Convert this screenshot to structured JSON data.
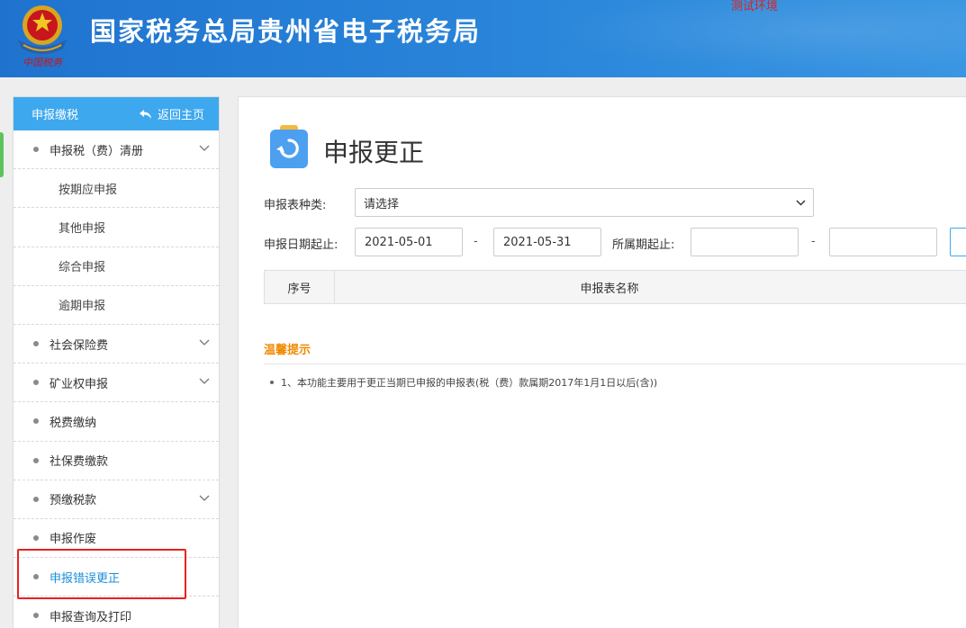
{
  "header": {
    "title": "国家税务总局贵州省电子税务局",
    "env_tag": "测试环境",
    "emblem_caption": "中国税务",
    "emblem": "tax-emblem-icon"
  },
  "sidebar": {
    "head_label": "申报缴税",
    "back_label": "返回主页",
    "items": [
      {
        "label": "申报税（费）清册",
        "type": "group",
        "expandable": true
      },
      {
        "label": "按期应申报",
        "type": "sub"
      },
      {
        "label": "其他申报",
        "type": "sub"
      },
      {
        "label": "综合申报",
        "type": "sub"
      },
      {
        "label": "逾期申报",
        "type": "sub"
      },
      {
        "label": "社会保险费",
        "type": "group",
        "expandable": true
      },
      {
        "label": "矿业权申报",
        "type": "group",
        "expandable": true
      },
      {
        "label": "税费缴纳",
        "type": "group",
        "expandable": false
      },
      {
        "label": "社保费缴款",
        "type": "group",
        "expandable": false
      },
      {
        "label": "预缴税款",
        "type": "group",
        "expandable": true
      },
      {
        "label": "申报作废",
        "type": "group",
        "expandable": false
      },
      {
        "label": "申报错误更正",
        "type": "group",
        "expandable": false,
        "active": true
      },
      {
        "label": "申报查询及打印",
        "type": "group",
        "expandable": false
      }
    ]
  },
  "main": {
    "title": "申报更正",
    "form": {
      "type_label": "申报表种类:",
      "type_value": "请选择",
      "date_label": "申报日期起止:",
      "date_start": "2021-05-01",
      "date_end": "2021-05-31",
      "dash": "-",
      "period_label": "所属期起止:",
      "period_start": "",
      "period_end": ""
    },
    "table": {
      "columns": [
        "序号",
        "申报表名称"
      ]
    },
    "tips": {
      "title": "温馨提示",
      "items": [
        "1、本功能主要用于更正当期已申报的申报表(税（费）款属期2017年1月1日以后(含))"
      ]
    }
  },
  "colors": {
    "header_blue": "#2a86da",
    "sidebar_head": "#3ea8ee",
    "active_text": "#1a8fd8",
    "tip_orange": "#f08a00",
    "highlight_red": "#e8211d"
  }
}
